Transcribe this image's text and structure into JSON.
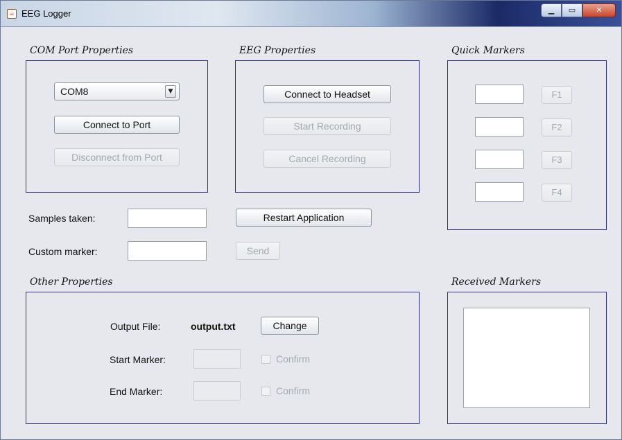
{
  "window": {
    "title": "EEG Logger",
    "app_icon": "java-cup-icon",
    "controls": [
      "minimize",
      "maximize",
      "close"
    ]
  },
  "com_port": {
    "label": "COM Port Properties",
    "selected_port": "COM8",
    "connect_label": "Connect to Port",
    "disconnect_label": "Disconnect from Port"
  },
  "eeg": {
    "label": "EEG Properties",
    "connect_label": "Connect to Headset",
    "start_label": "Start Recording",
    "cancel_label": "Cancel Recording"
  },
  "quick_markers": {
    "label": "Quick Markers",
    "items": [
      {
        "value": "",
        "key": "F1"
      },
      {
        "value": "",
        "key": "F2"
      },
      {
        "value": "",
        "key": "F3"
      },
      {
        "value": "",
        "key": "F4"
      }
    ]
  },
  "samples": {
    "label": "Samples taken:",
    "value": ""
  },
  "custom_marker": {
    "label": "Custom marker:",
    "value": "",
    "send_label": "Send"
  },
  "restart_label": "Restart Application",
  "other": {
    "label": "Other Properties",
    "output_file_label": "Output File:",
    "output_file_value": "output.txt",
    "change_label": "Change",
    "start_marker_label": "Start Marker:",
    "end_marker_label": "End Marker:",
    "confirm_label": "Confirm"
  },
  "received": {
    "label": "Received Markers",
    "items": []
  }
}
